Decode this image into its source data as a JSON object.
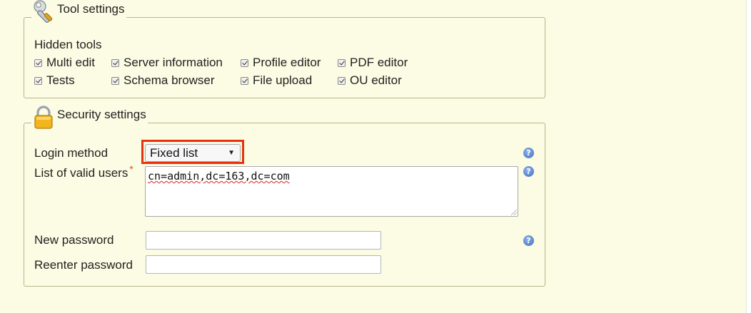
{
  "tool_settings": {
    "legend": "Tool settings",
    "icon": "wrench-icon",
    "hidden_tools_label": "Hidden tools",
    "tools": [
      {
        "label": "Multi edit",
        "checked": true
      },
      {
        "label": "Server information",
        "checked": true
      },
      {
        "label": "Profile editor",
        "checked": true
      },
      {
        "label": "PDF editor",
        "checked": true
      },
      {
        "label": "Tests",
        "checked": true
      },
      {
        "label": "Schema browser",
        "checked": true
      },
      {
        "label": "File upload",
        "checked": true
      },
      {
        "label": "OU editor",
        "checked": true
      }
    ]
  },
  "security_settings": {
    "legend": "Security settings",
    "icon": "padlock-icon",
    "login_method_label": "Login method",
    "login_method_value": "Fixed list",
    "valid_users_label": "List of valid users",
    "required_mark": "*",
    "valid_users_value": "cn=admin,dc=163,dc=com",
    "new_password_label": "New password",
    "new_password_value": "",
    "reenter_password_label": "Reenter password",
    "reenter_password_value": "",
    "help_glyph": "?"
  },
  "colors": {
    "background": "#fcfbe3",
    "fieldset_border": "#b9b58a",
    "highlight": "#e8320f",
    "help_icon": "#3d6fc4"
  }
}
